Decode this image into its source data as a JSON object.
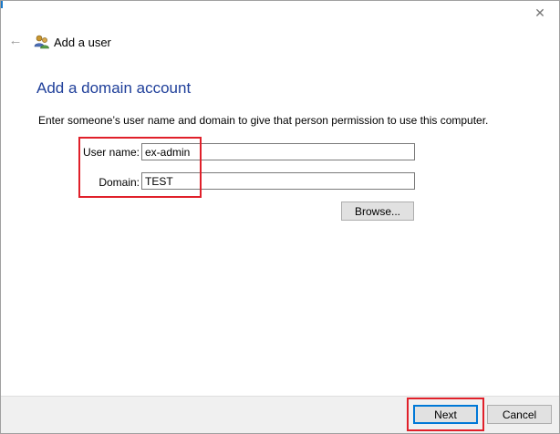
{
  "window": {
    "title": "Add a user",
    "close_glyph": "✕",
    "back_glyph": "←"
  },
  "content": {
    "heading": "Add a domain account",
    "instructions": "Enter someone’s user name and domain to give that person permission to use this computer.",
    "user_name": {
      "label": "User name:",
      "value": "ex-admin"
    },
    "domain": {
      "label": "Domain:",
      "value": "TEST"
    },
    "browse_label": "Browse..."
  },
  "footer": {
    "next_label": "Next",
    "cancel_label": "Cancel"
  },
  "colors": {
    "heading": "#1f3f9a",
    "highlight": "#e0202a",
    "accent": "#0078d7"
  }
}
